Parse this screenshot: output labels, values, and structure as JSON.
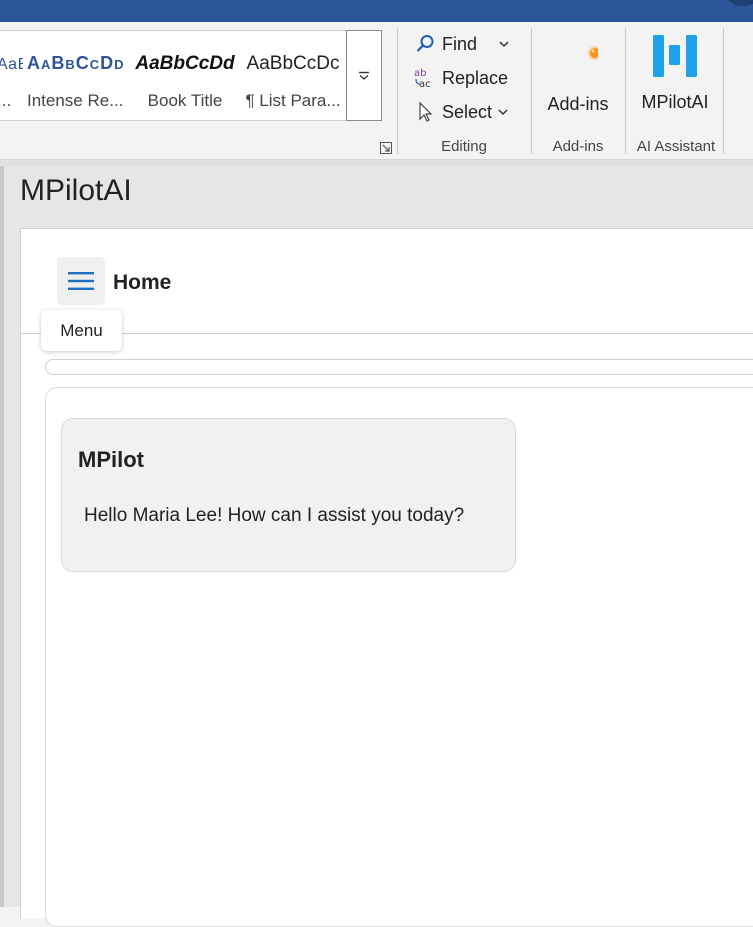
{
  "ribbon": {
    "styles": [
      {
        "sample": "AaBbCcDd",
        "name": "..."
      },
      {
        "sample": "AaBbCcDd",
        "name": "Intense Re..."
      },
      {
        "sample": "AaBbCcDd",
        "name": "Book Title"
      },
      {
        "sample": "AaBbCcDc",
        "name": "¶ List Para..."
      }
    ],
    "editing": {
      "find": "Find",
      "replace": "Replace",
      "select": "Select",
      "group_label": "Editing"
    },
    "addins": {
      "button_label": "Add-ins",
      "group_label": "Add-ins"
    },
    "ai": {
      "button_label": "MPilotAI",
      "group_label": "AI Assistant"
    }
  },
  "pane": {
    "title": "MPilotAI",
    "header": {
      "home_label": "Home",
      "tooltip": "Menu"
    },
    "chat": {
      "messages": [
        {
          "sender": "MPilot",
          "text": "Hello Maria Lee! How can I assist you today?"
        }
      ]
    }
  },
  "colors": {
    "titlebar": "#2b579a",
    "style_accent": "#2f5496",
    "addin_dot": "#f7941d",
    "mpilot_logo": "#1ea1e8",
    "menu_icon": "#1f6fc4"
  },
  "icons": {
    "find": "search-icon",
    "replace": "replace-icon",
    "select": "cursor-icon",
    "menu": "hamburger-icon"
  }
}
